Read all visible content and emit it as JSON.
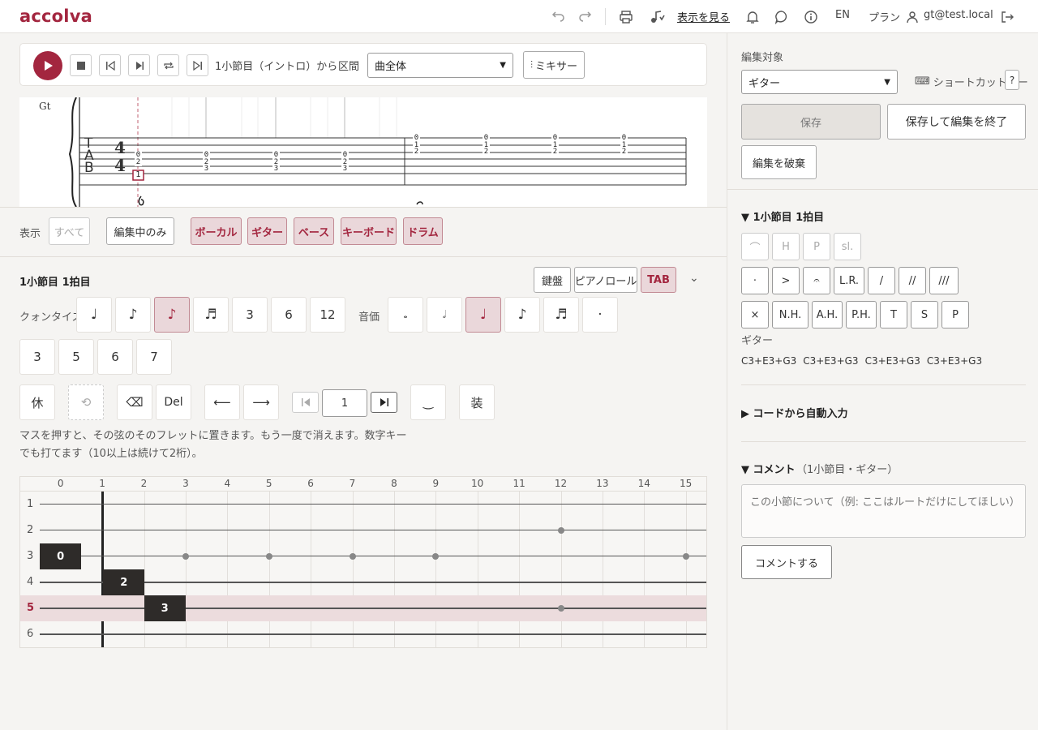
{
  "app": {
    "logo": "accolva"
  },
  "topbar": {
    "view_label": "表示を見る",
    "lang": "EN",
    "plan": "プラン",
    "user": "gt@test.local"
  },
  "player": {
    "position": "1小節目（イントロ）から",
    "section_label": "区間",
    "section_value": "曲全体",
    "mixer": "ミキサー"
  },
  "sheet": {
    "part": "Gt",
    "tab_letters": [
      "T",
      "A",
      "B"
    ],
    "time_sig": [
      "4",
      "4"
    ],
    "m1": [
      [
        "0",
        "2",
        "3"
      ],
      [
        "0",
        "2",
        "3"
      ],
      [
        "0",
        "2",
        "3"
      ],
      [
        "0",
        "2",
        "3"
      ]
    ],
    "m2": [
      [
        "0",
        "1",
        "2"
      ],
      [
        "0",
        "1",
        "2"
      ],
      [
        "0",
        "1",
        "2"
      ],
      [
        "0",
        "1",
        "2"
      ]
    ],
    "cursor_fret": "1"
  },
  "display": {
    "label": "表示",
    "all": "すべて",
    "editing_only": "編集中のみ",
    "parts": [
      "ボーカル",
      "ギター",
      "ベース",
      "キーボード",
      "ドラム"
    ]
  },
  "editor": {
    "position": "1小節目 1拍目",
    "views": [
      "鍵盤",
      "ピアノロール",
      "TAB"
    ],
    "quantize_label": "クォンタイズ",
    "quantize": [
      "♩",
      "♪",
      "♪",
      "♬",
      "3",
      "6",
      "12"
    ],
    "duration_label": "音価",
    "durations": [
      "𝅝",
      "𝅗𝅥",
      "♩",
      "♪",
      "♬",
      "·"
    ],
    "tuplets": [
      "3",
      "5",
      "6",
      "7"
    ],
    "tools": [
      "休",
      "⟲",
      "⌫",
      "Del",
      "⟵",
      "⟶"
    ],
    "measure_value": "1",
    "tie": "‿",
    "ornament": "装",
    "hint": "マスを押すと、その弦のそのフレットに置きます。もう一度で消えます。数字キーでも打てます（10以上は続けて2桁）。"
  },
  "fretboard": {
    "frets": [
      "0",
      "1",
      "2",
      "3",
      "4",
      "5",
      "6",
      "7",
      "8",
      "9",
      "10",
      "11",
      "12",
      "13",
      "14",
      "15"
    ],
    "strings": [
      "1",
      "2",
      "3",
      "4",
      "5",
      "6"
    ],
    "active_string": "5",
    "notes": [
      {
        "string": 3,
        "fret": 0,
        "label": "0"
      },
      {
        "string": 4,
        "fret": 2,
        "label": "2"
      },
      {
        "string": 5,
        "fret": 3,
        "label": "3"
      }
    ]
  },
  "sidebar": {
    "target_label": "編集対象",
    "target_value": "ギター",
    "shortcut": "ショートカットキー",
    "shortcut_q": "?",
    "save": "保存",
    "save_exit": "保存して編集を終了",
    "discard": "編集を破棄",
    "section_title": "▼ 1小節目 1拍目",
    "art_row1": [
      "⌒",
      "H",
      "P",
      "sl."
    ],
    "art_row2": [
      "·",
      ">",
      "𝄐",
      "L.R.",
      "/",
      "//",
      "///"
    ],
    "art_row3": [
      "×",
      "N.H.",
      "A.H.",
      "P.H.",
      "T",
      "S",
      "P"
    ],
    "instrument": "ギター",
    "chords": [
      "C3+E3+G3",
      "C3+E3+G3",
      "C3+E3+G3",
      "C3+E3+G3"
    ],
    "auto_fill": "▶ コードから自動入力",
    "comment_title": "▼ コメント",
    "comment_ctx": "（1小節目・ギター）",
    "comment_placeholder": "この小節について（例: ここはルートだけにしてほしい）",
    "comment_btn": "コメントする"
  },
  "colors": {
    "accent": "#a3263f",
    "accent_bg": "#ead7da"
  }
}
